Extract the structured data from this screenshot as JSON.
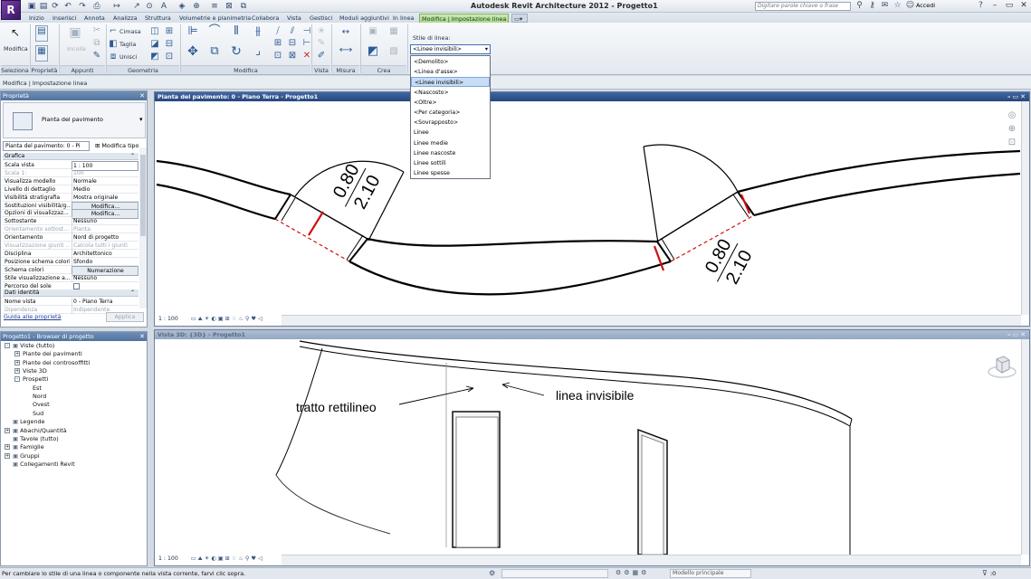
{
  "app": {
    "logo_letter": "R",
    "title": "Autodesk Revit Architecture 2012 -    Progetto1",
    "search_placeholder": "Digitare parole chiave o frase",
    "signin_label": "Accedi"
  },
  "tabs": [
    "Inizio",
    "Inserisci",
    "Annota",
    "Analizza",
    "Struttura",
    "Volumetrie e planimetria",
    "Collabora",
    "Vista",
    "Gestisci",
    "Moduli aggiuntivi",
    "In linea",
    "Modifica | Impostazione linea"
  ],
  "active_tab_index": 11,
  "ribbon": {
    "panels": [
      "Seleziona",
      "Proprietà",
      "Appunti",
      "Geometria",
      "Modifica",
      "Vista",
      "Misura",
      "Crea"
    ],
    "modify_label": "Modifica",
    "props_label": "Proprietà",
    "paste_label": "Incolla",
    "geometry_buttons": [
      "Cimasa",
      "Taglia",
      "Unisci"
    ],
    "line_style_label": "Stile di linea:"
  },
  "context_bar_label": "Modifica | Impostazione linea",
  "line_style_dropdown": {
    "selected": "<Linee invisibili>",
    "options": [
      "<Demolito>",
      "<Linea d'asse>",
      "<Linee invisibili>",
      "<Nascosto>",
      "<Oltre>",
      "<Per categoria>",
      "<Sovrapposto>",
      "Linee",
      "Linee medie",
      "Linee nascoste",
      "Linee sottili",
      "Linee spesse"
    ],
    "highlighted_index": 2
  },
  "properties": {
    "header": "Proprietà",
    "type_name": "Pianta del pavimento",
    "instance_selector": "Pianta del pavimento: 0 - Pi",
    "edit_type_label": "Modifica tipo",
    "section_graphics": "Grafica",
    "rows": [
      {
        "k": "Scala vista",
        "v": "1 : 100",
        "box": true
      },
      {
        "k": "Scala  1:",
        "v": "100",
        "dis": true
      },
      {
        "k": "Visualizza modello",
        "v": "Normale"
      },
      {
        "k": "Livello di dettaglio",
        "v": "Medio"
      },
      {
        "k": "Visibilità stratigrafia",
        "v": "Mostra originale"
      },
      {
        "k": "Sostituzioni visibilità/g...",
        "v": "Modifica...",
        "btn": true
      },
      {
        "k": "Opzioni di visualizzaz...",
        "v": "Modifica...",
        "btn": true
      },
      {
        "k": "Sottostante",
        "v": "Nessuno"
      },
      {
        "k": "Orientamento sottost...",
        "v": "Pianta",
        "dis": true
      },
      {
        "k": "Orientamento",
        "v": "Nord di progetto"
      },
      {
        "k": "Visualizzazione giunti ...",
        "v": "Calcola tutti i giunti",
        "dis": true
      },
      {
        "k": "Disciplina",
        "v": "Architettonico"
      },
      {
        "k": "Posizione schema colori",
        "v": "Sfondo"
      },
      {
        "k": "Schema colori",
        "v": "Numerazione",
        "btn": true
      },
      {
        "k": "Stile visualizzazione a...",
        "v": "Nessuno"
      },
      {
        "k": "Percorso del sole",
        "v": "",
        "check": true
      }
    ],
    "section_identity": "Dati identità",
    "identity_rows": [
      {
        "k": "Nome vista",
        "v": "0 - Piano Terra"
      },
      {
        "k": "Dipendenza",
        "v": "Indipendente",
        "dis": true
      }
    ],
    "help_link": "Guida alle proprietà",
    "apply_label": "Applica"
  },
  "browser": {
    "header": "Progetto1 - Browser di progetto",
    "nodes": [
      {
        "label": "Viste (tutto)",
        "level": 0,
        "box": "-"
      },
      {
        "label": "Piante dei pavimenti",
        "level": 1,
        "box": "+"
      },
      {
        "label": "Piante dei controsoffitti",
        "level": 1,
        "box": "+"
      },
      {
        "label": "Viste 3D",
        "level": 1,
        "box": "+"
      },
      {
        "label": "Prospetti",
        "level": 1,
        "box": "-"
      },
      {
        "label": "Est",
        "level": 2
      },
      {
        "label": "Nord",
        "level": 2
      },
      {
        "label": "Ovest",
        "level": 2
      },
      {
        "label": "Sud",
        "level": 2
      },
      {
        "label": "Legende",
        "level": 0
      },
      {
        "label": "Abachi/Quantità",
        "level": 0,
        "box": "+"
      },
      {
        "label": "Tavole (tutto)",
        "level": 0
      },
      {
        "label": "Famiglie",
        "level": 0,
        "box": "+"
      },
      {
        "label": "Gruppi",
        "level": 0,
        "box": "+"
      },
      {
        "label": "Collegamenti Revit",
        "level": 0
      }
    ]
  },
  "plan_view": {
    "title": "Pianta del pavimento: 0 - Piano Terra - Progetto1",
    "scale": "1 : 100",
    "door_tag_1": {
      "w": "0.80",
      "h": "2.10"
    },
    "door_tag_2": {
      "w": "0.80",
      "h": "2.10"
    }
  },
  "view_3d": {
    "title": "Vista 3D: {3D} - Progetto1",
    "scale": "1 : 100",
    "annotation_left": "tratto rettilineo",
    "annotation_right": "linea invisibile"
  },
  "status": {
    "text": "Per cambiare lo stile di una linea o componente nella vista corrente, farvi clic sopra.",
    "workset": "Modello principale",
    "filter_count": ":0"
  },
  "colors": {
    "active_tab": "#a8d88a",
    "view_header_active": "#27477e",
    "invisible_line": "#d01010"
  }
}
